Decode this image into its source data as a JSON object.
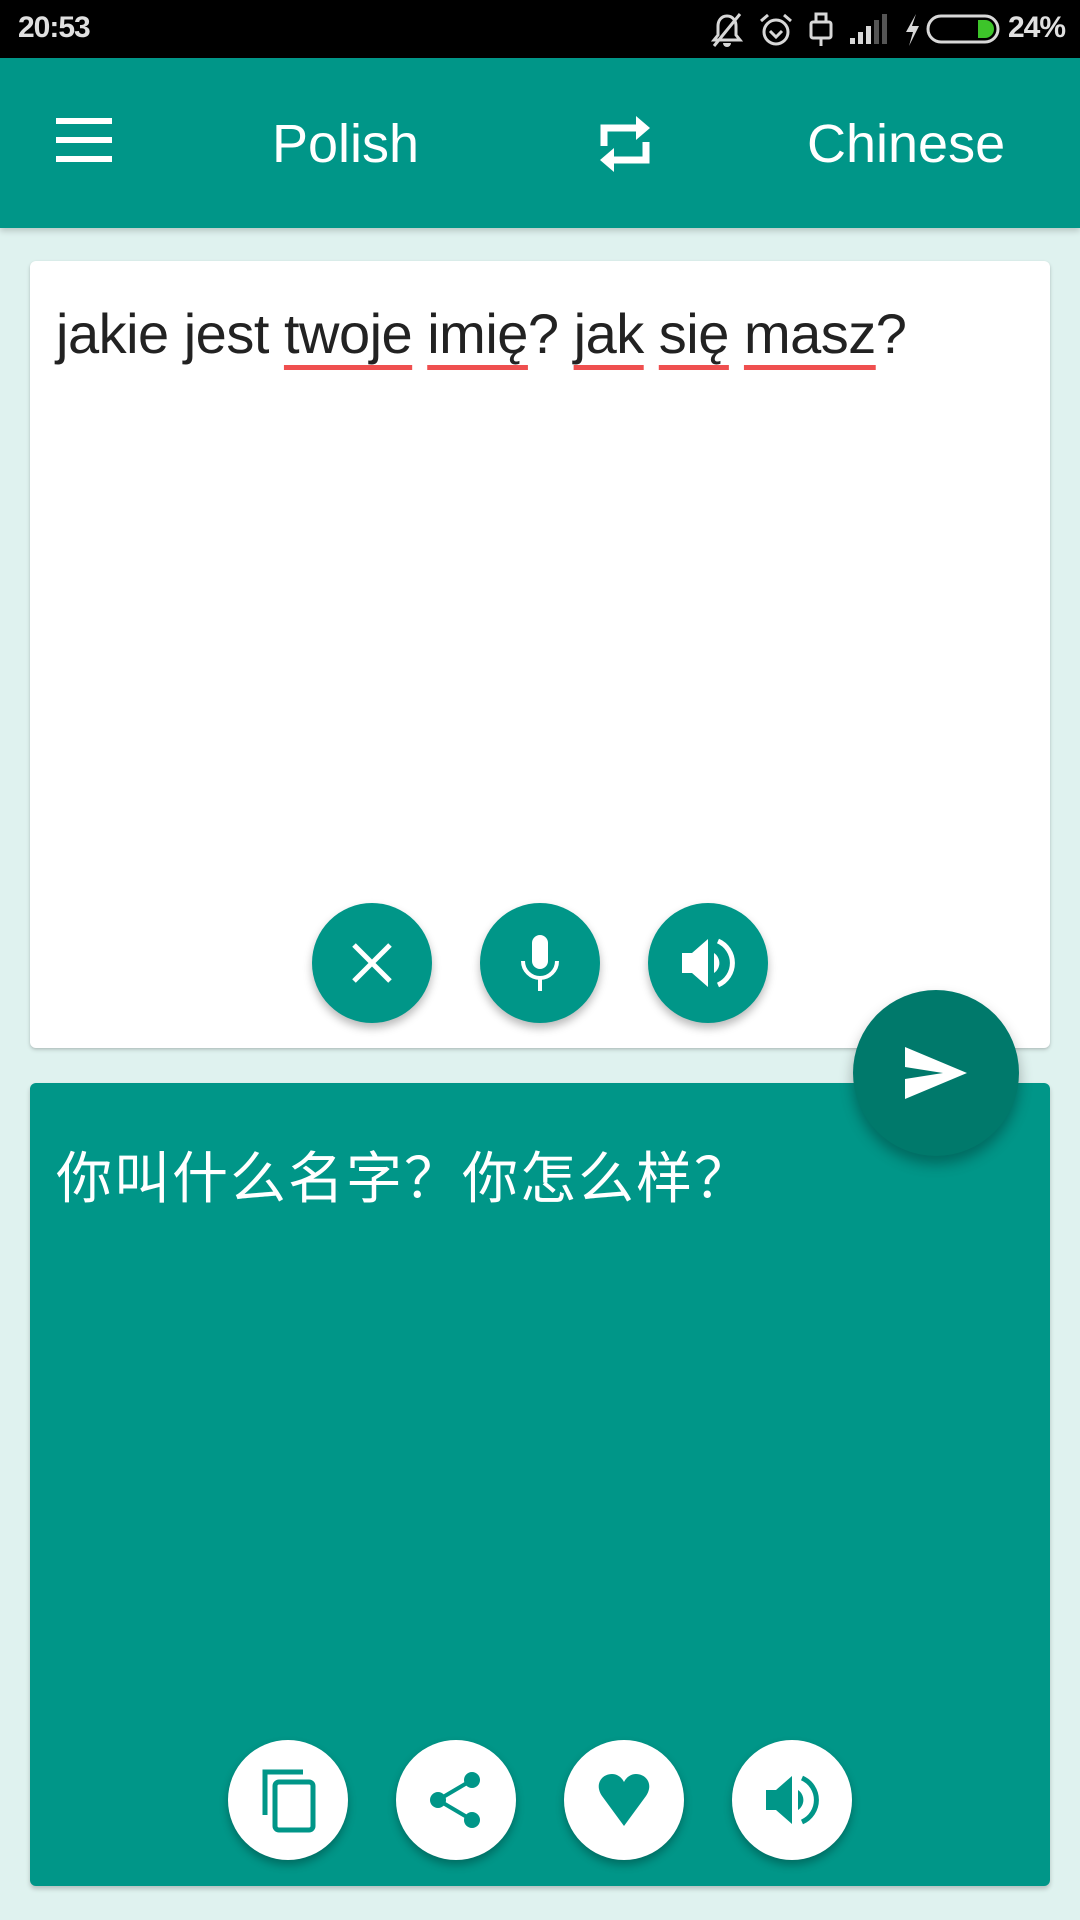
{
  "status_bar": {
    "time": "20:53",
    "icons": [
      "notifications-off-icon",
      "alarm-icon",
      "usb-icon",
      "signal-icon",
      "charging-bolt-icon",
      "battery-icon"
    ],
    "battery_percent": "24%",
    "battery_level": 0.24
  },
  "toolbar": {
    "menu_icon": "hamburger-menu-icon",
    "source_language": "Polish",
    "swap_icon": "swap-languages-icon",
    "target_language": "Chinese"
  },
  "input": {
    "text_segments": [
      {
        "text": "jakie jest ",
        "misspelled": false
      },
      {
        "text": "twoje",
        "misspelled": true
      },
      {
        "text": " ",
        "misspelled": false
      },
      {
        "text": "imię",
        "misspelled": true
      },
      {
        "text": "? ",
        "misspelled": false
      },
      {
        "text": "jak",
        "misspelled": true
      },
      {
        "text": " ",
        "misspelled": false
      },
      {
        "text": "się",
        "misspelled": true
      },
      {
        "text": " ",
        "misspelled": false
      },
      {
        "text": "masz",
        "misspelled": true
      },
      {
        "text": "?",
        "misspelled": false
      }
    ],
    "buttons": [
      {
        "name": "clear",
        "icon": "close-icon"
      },
      {
        "name": "voice-input",
        "icon": "microphone-icon"
      },
      {
        "name": "speak-source",
        "icon": "speaker-icon"
      }
    ]
  },
  "translate_button": {
    "icon": "send-icon"
  },
  "output": {
    "text": "你叫什么名字？你怎么样？",
    "buttons": [
      {
        "name": "copy",
        "icon": "copy-icon"
      },
      {
        "name": "share",
        "icon": "share-icon"
      },
      {
        "name": "favorite",
        "icon": "heart-icon"
      },
      {
        "name": "speak-translation",
        "icon": "speaker-icon"
      }
    ]
  },
  "colors": {
    "primary": "#009688",
    "primary_dark": "#00796b",
    "background": "#dff2ef",
    "spellcheck_underline": "#ef4f4f",
    "battery_fill": "#3dc42a"
  }
}
